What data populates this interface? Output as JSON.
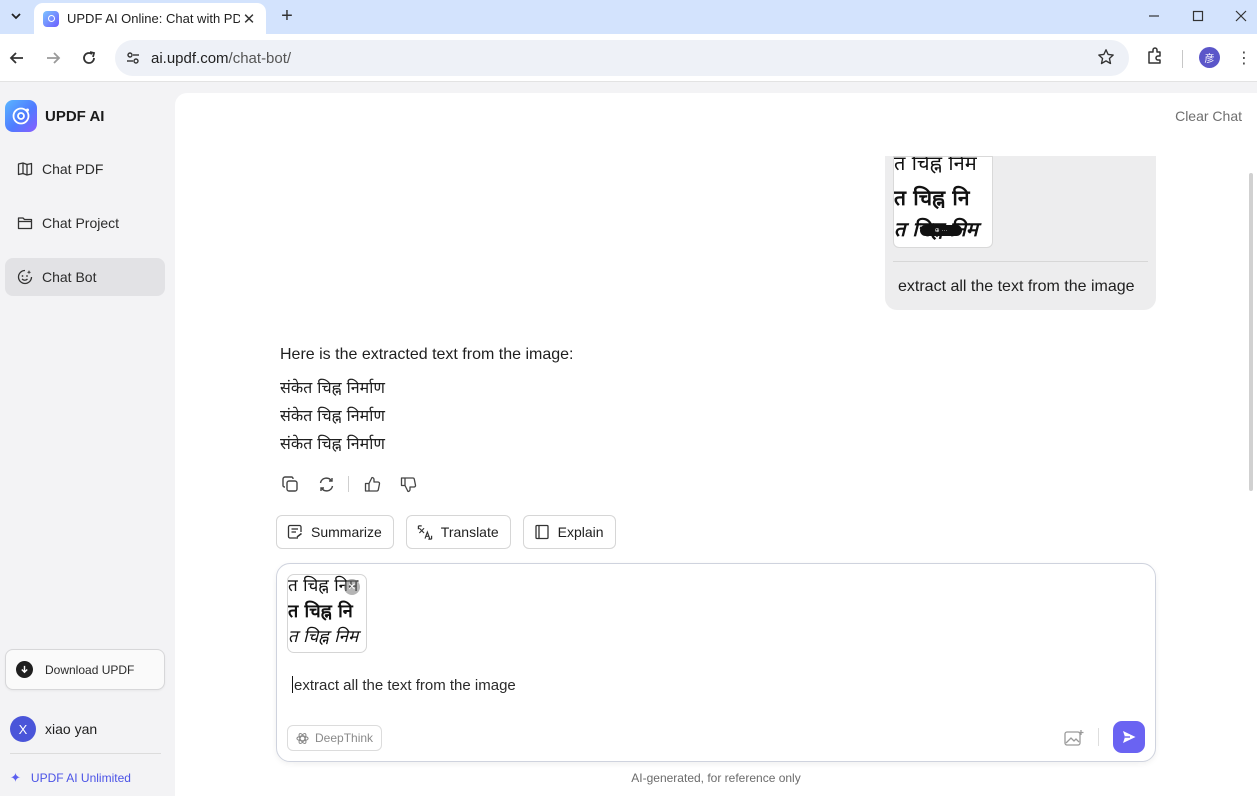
{
  "browser": {
    "tab_title": "UPDF AI Online: Chat with PDF",
    "url_domain": "ai.updf.com",
    "url_path": "/chat-bot/",
    "profile_initial": "彦"
  },
  "sidebar": {
    "brand": "UPDF AI",
    "items": [
      {
        "label": "Chat PDF",
        "icon": "book-open-icon"
      },
      {
        "label": "Chat Project",
        "icon": "folder-icon"
      },
      {
        "label": "Chat Bot",
        "icon": "bot-face-icon",
        "active": true
      }
    ],
    "download_label": "Download UPDF",
    "user_initial": "X",
    "user_name": "xiao yan",
    "plan_label": "UPDF AI Unlimited"
  },
  "main": {
    "clear_chat": "Clear Chat",
    "user_message": {
      "text": "extract all the text from the image",
      "thumb_lines": [
        "त चिह्न निम",
        "त चिह्न नि",
        "त चिह्न निम"
      ]
    },
    "ai_message": {
      "intro": "Here is the extracted text from the image:",
      "lines": [
        "संकेत चिह्न निर्माण",
        "संकेत चिह्न निर्माण",
        "संकेत चिह्न निर्माण"
      ]
    },
    "chips": [
      {
        "label": "Summarize",
        "icon": "summarize-icon"
      },
      {
        "label": "Translate",
        "icon": "translate-icon"
      },
      {
        "label": "Explain",
        "icon": "book-icon"
      }
    ],
    "composer": {
      "thumb_lines": [
        "त चिह्न निम",
        "त चिह्न नि",
        "त चिह्न निम"
      ],
      "input_value": "extract all the text from the image",
      "deepthink_label": "DeepThink"
    },
    "disclaimer": "AI-generated, for reference only"
  },
  "colors": {
    "accent": "#6a63f2",
    "brand_link": "#4b53e6",
    "tabstrip": "#d3e3fd"
  }
}
